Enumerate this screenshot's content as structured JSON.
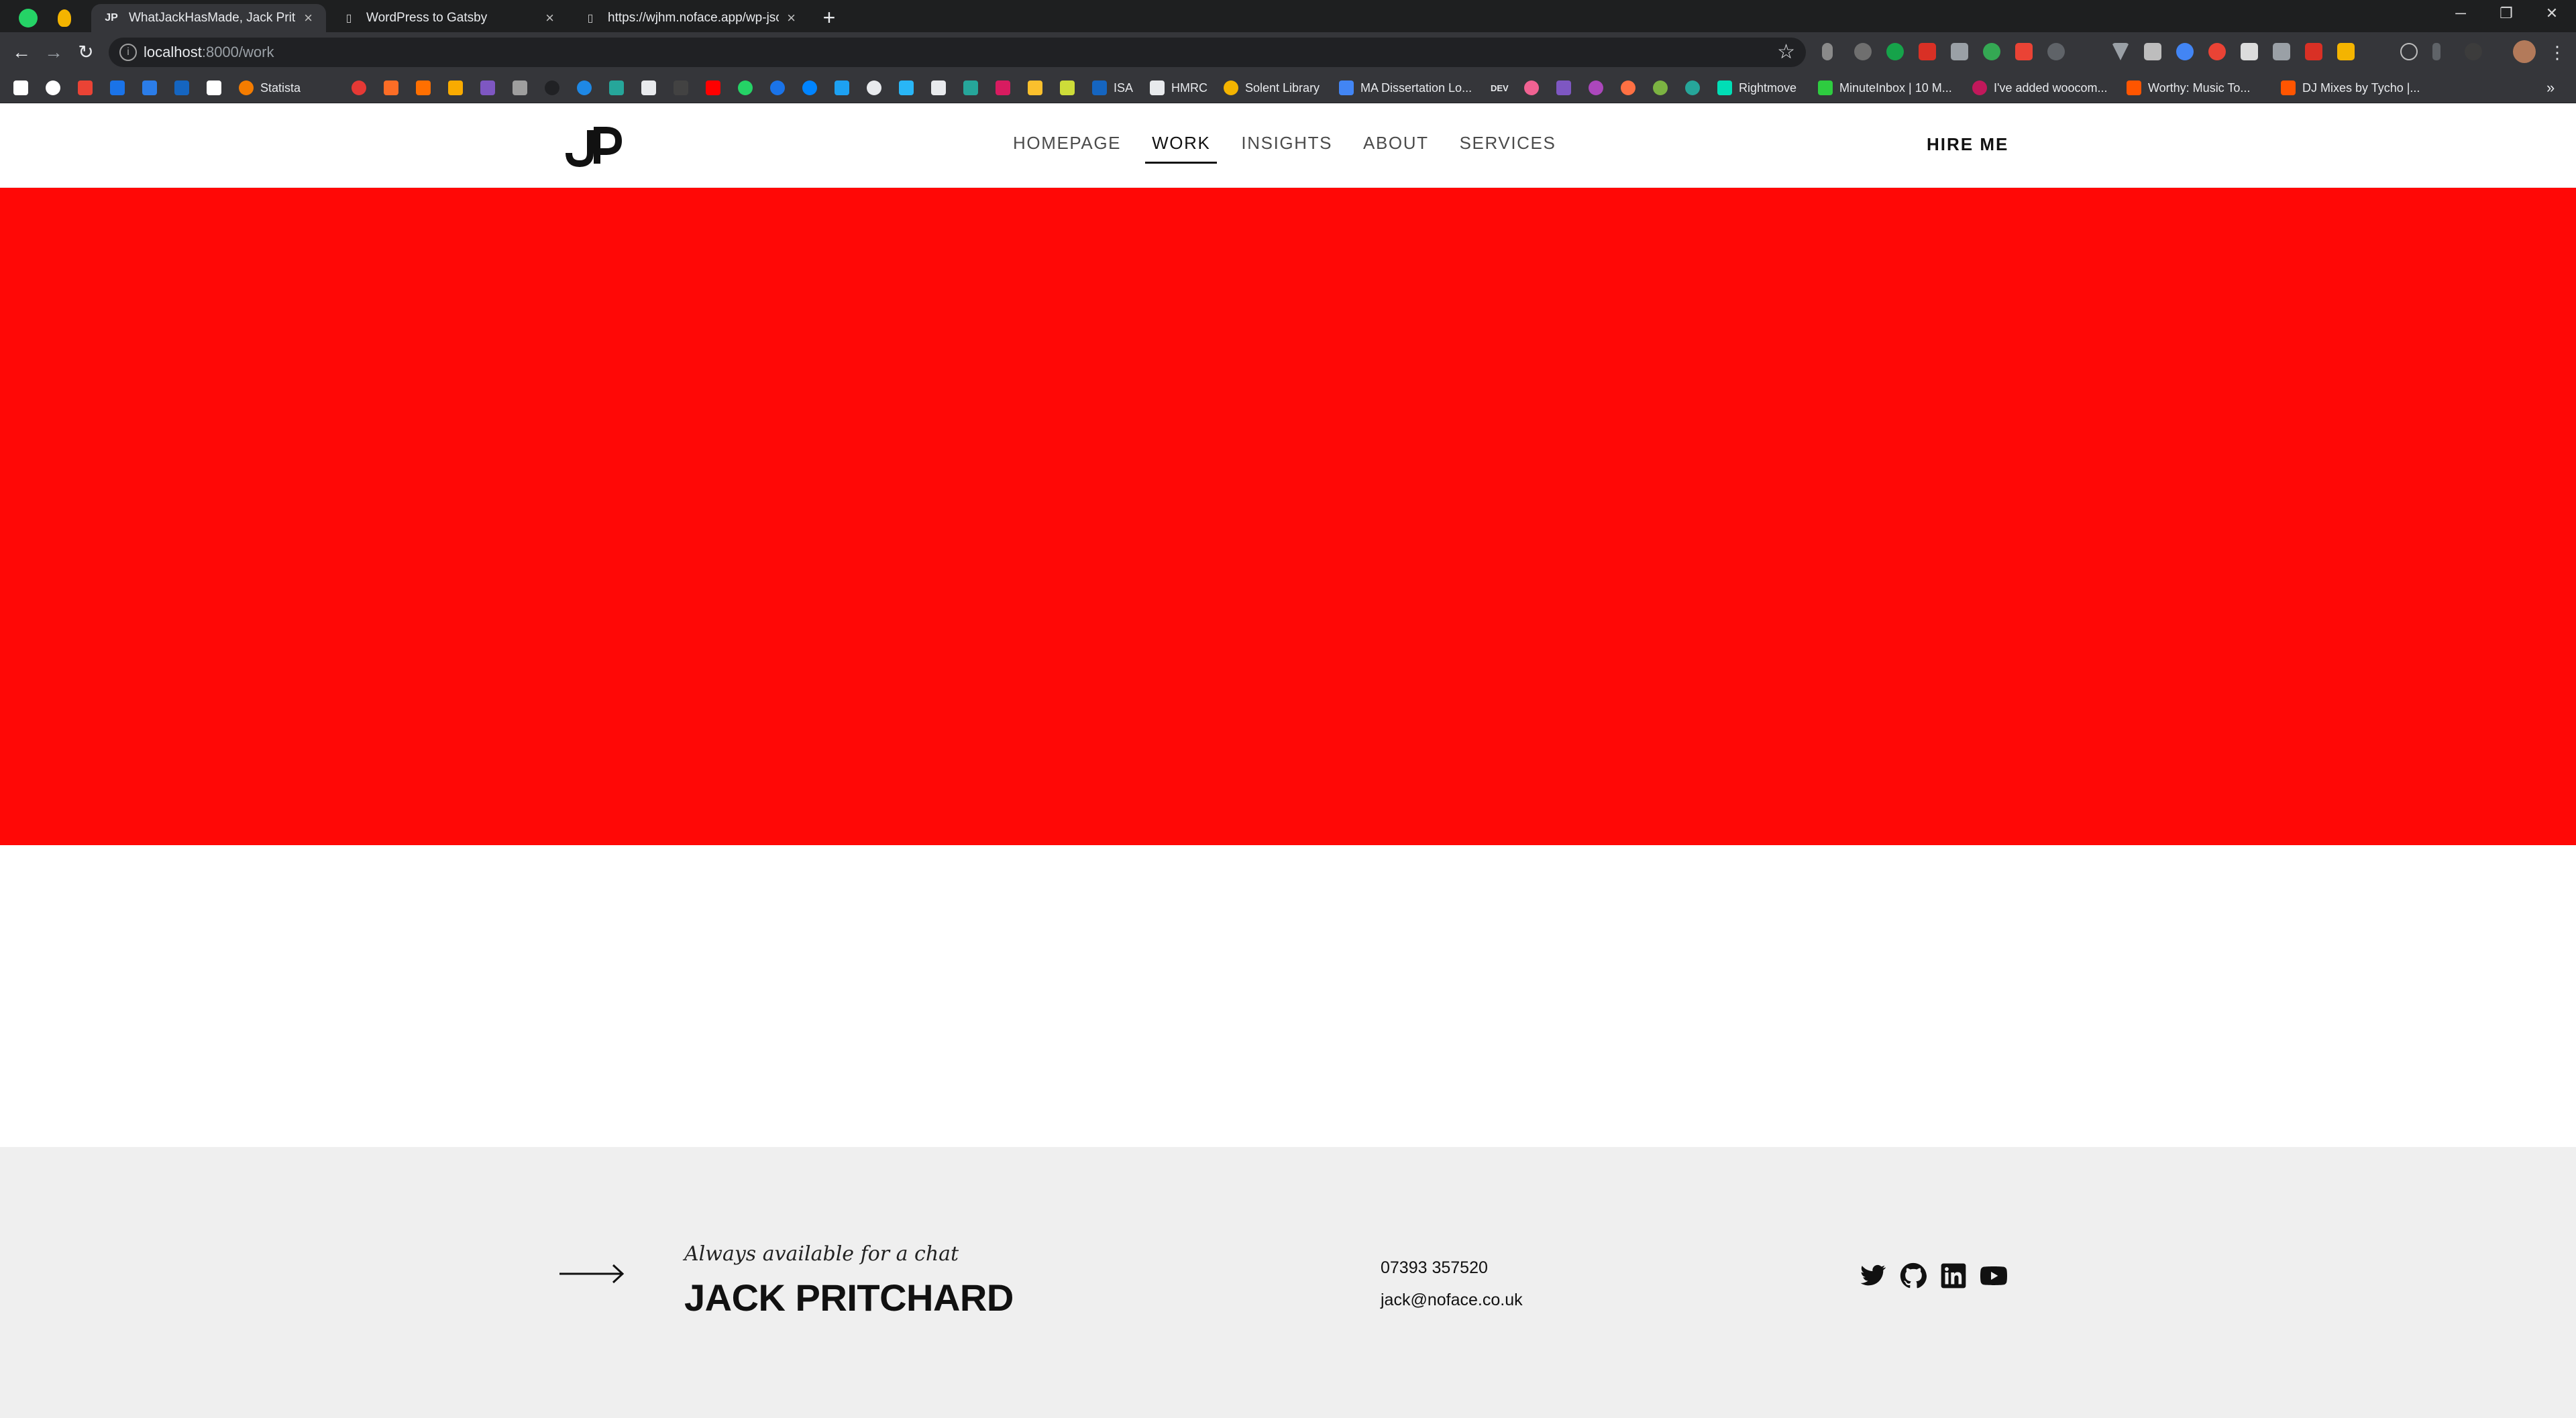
{
  "browser": {
    "tabs": [
      {
        "title": "WhatJackHasMade, Jack Pritchar",
        "icon": "jp-favicon",
        "active": true
      },
      {
        "title": "WordPress to Gatsby",
        "icon": "document-icon",
        "active": false
      },
      {
        "title": "https://wjhm.noface.app/wp-json",
        "icon": "document-icon",
        "active": false
      }
    ],
    "new_tab": "+",
    "controls": {
      "minimize": "─",
      "restore": "❐",
      "close": "✕"
    },
    "toolbar": {
      "back": "←",
      "forward": "→",
      "reload": "↻",
      "info": "i",
      "star": "☆"
    },
    "url": {
      "host": "localhost",
      "path": ":8000/work"
    },
    "bookmarks": [
      {
        "label": "Statista"
      },
      {
        "label": "ISA"
      },
      {
        "label": "HMRC"
      },
      {
        "label": "Solent Library"
      },
      {
        "label": "MA Dissertation Lo..."
      },
      {
        "label": "DEV"
      },
      {
        "label": "Rightmove"
      },
      {
        "label": "MinuteInbox | 10 M..."
      },
      {
        "label": "I've added woocom..."
      },
      {
        "label": "Worthy: Music To..."
      },
      {
        "label": "DJ Mixes by Tycho |..."
      },
      {
        "label": "»"
      }
    ]
  },
  "site": {
    "logo": "JP",
    "nav": [
      {
        "label": "HOMEPAGE",
        "active": false
      },
      {
        "label": "WORK",
        "active": true
      },
      {
        "label": "INSIGHTS",
        "active": false
      },
      {
        "label": "ABOUT",
        "active": false
      },
      {
        "label": "SERVICES",
        "active": false
      }
    ],
    "hire_label": "HIRE ME",
    "hero_color": "#ff0806",
    "footer": {
      "tagline": "Always available for a chat",
      "name": "JACK PRITCHARD",
      "phone": "07393 357520",
      "email": "jack@noface.co.uk",
      "social": [
        "twitter-icon",
        "github-icon",
        "linkedin-icon",
        "youtube-icon"
      ]
    }
  }
}
